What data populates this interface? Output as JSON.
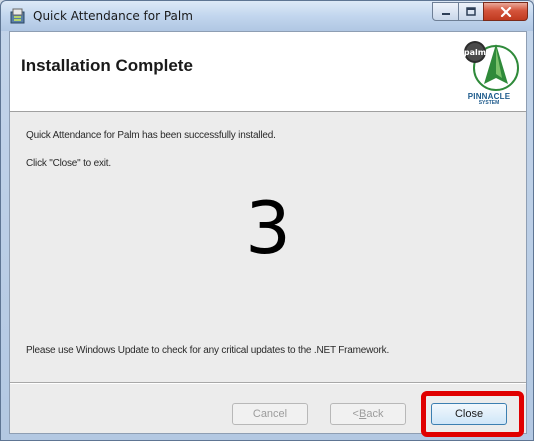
{
  "window": {
    "title": "Quick Attendance for Palm",
    "app_icon": "installer-icon",
    "controls": [
      "minimize-icon",
      "maximize-icon",
      "close-icon"
    ]
  },
  "header": {
    "title": "Installation Complete",
    "logo": {
      "icon": "pinnacle-palm-logo",
      "badge": "palm",
      "name": "PINNACLE",
      "sub": "SYSTEM"
    }
  },
  "content": {
    "success_message": "Quick Attendance for Palm has been successfully installed.",
    "exit_hint": "Click \"Close\" to exit.",
    "step_number": "3",
    "update_notice": "Please use Windows Update to check for any critical updates to the .NET Framework."
  },
  "buttons": {
    "cancel": "Cancel",
    "back_prefix": "< ",
    "back_accel": "B",
    "back_rest": "ack",
    "close": "Close"
  },
  "colors": {
    "highlight": "#e00000",
    "logo_blue": "#1e5b8c",
    "logo_green": "#2f8a3a"
  }
}
